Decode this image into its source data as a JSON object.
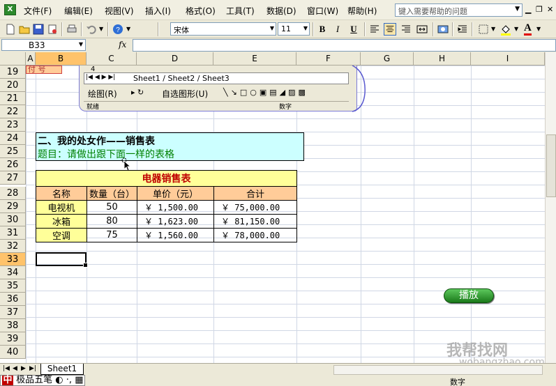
{
  "menubar": {
    "items": [
      "文件(F)",
      "编辑(E)",
      "视图(V)",
      "插入(I)",
      "格式(O)",
      "工具(T)",
      "数据(D)",
      "窗口(W)",
      "帮助(H)"
    ],
    "help_placeholder": "键入需要帮助的问题"
  },
  "toolbar": {
    "font_name": "宋体",
    "font_size": "11",
    "bold": "B",
    "italic": "I",
    "underline": "U"
  },
  "formula": {
    "name_box": "B33",
    "fx": "fx",
    "value": ""
  },
  "columns": [
    "A",
    "B",
    "C",
    "D",
    "E",
    "F",
    "G",
    "H",
    "I"
  ],
  "rows": [
    "19",
    "20",
    "21",
    "22",
    "23",
    "24",
    "25",
    "26",
    "27",
    "28",
    "29",
    "30",
    "31",
    "32",
    "33",
    "34",
    "35",
    "36",
    "37",
    "38",
    "39",
    "40"
  ],
  "embedded": {
    "row_num": "4",
    "tabs": "Sheet1 / Sheet2 / Sheet3",
    "draw_label": "绘图(R)",
    "autoshape_label": "自选图形(U)",
    "status_ready": "就绪",
    "status_num": "数字",
    "partial_cell": "付 号"
  },
  "banner": {
    "title": "二、我的处女作——销售表",
    "subtitle": "题目：请做出跟下面一样的表格"
  },
  "table": {
    "title": "电器销售表",
    "headers": [
      "名称",
      "数量（台）",
      "单价（元）",
      "合计"
    ],
    "rows": [
      {
        "name": "电视机",
        "qty": "50",
        "price": "￥  1,500.00",
        "total": "￥  75,000.00"
      },
      {
        "name": "冰箱",
        "qty": "80",
        "price": "￥  1,623.00",
        "total": "￥  81,150.00"
      },
      {
        "name": "空调",
        "qty": "75",
        "price": "￥  1,560.00",
        "total": "￥  78,000.00"
      }
    ]
  },
  "play_button": "播放",
  "sheet_tab": "Sheet1",
  "status": {
    "ime": "极品五笔",
    "mode": "数字"
  },
  "watermark": {
    "main": "我帮找网",
    "sub": "wobangzhao.com"
  }
}
